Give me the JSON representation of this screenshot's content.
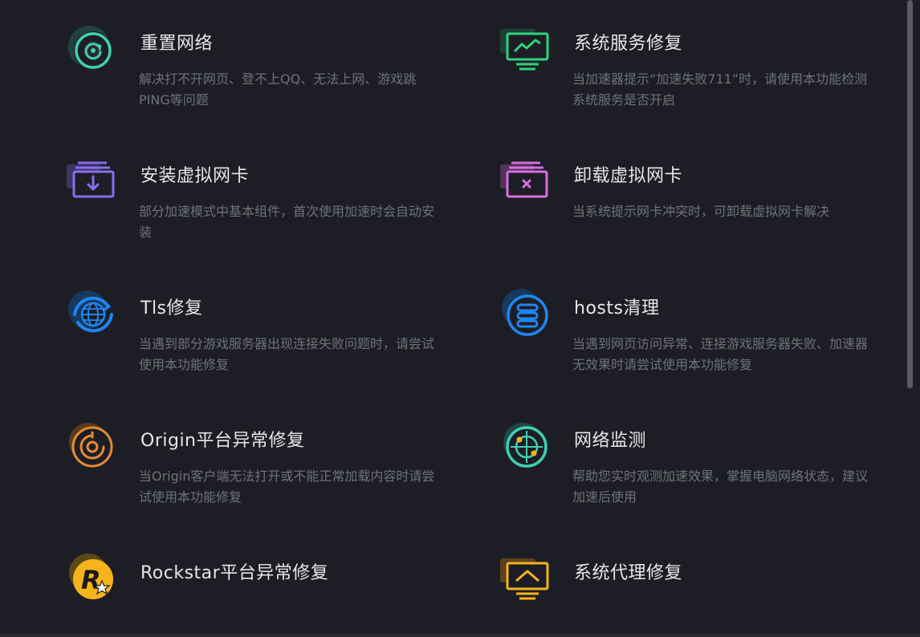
{
  "colors": {
    "background": "#1d1e25",
    "title": "#e6e7ec",
    "description": "#6f7179",
    "teal": "#3fd0b4",
    "green": "#2fd37d",
    "purple": "#8a6cf0",
    "pink": "#d86fe0",
    "blue": "#1f86f2",
    "orange": "#e58a36",
    "yellow": "#f5b41c"
  },
  "tools": [
    {
      "icon": "network-reset-icon",
      "title": "重置网络",
      "desc": "解决打不开网页、登不上QQ、无法上网、游戏跳PING等问题"
    },
    {
      "icon": "system-service-monitor-icon",
      "title": "系统服务修复",
      "desc": "当加速器提示“加速失败711”时，请使用本功能检测系统服务是否开启"
    },
    {
      "icon": "install-adapter-icon",
      "title": "安装虚拟网卡",
      "desc": "部分加速模式中基本组件，首次使用加速时会自动安装"
    },
    {
      "icon": "uninstall-adapter-icon",
      "title": "卸载虚拟网卡",
      "desc": "当系统提示网卡冲突时，可卸载虚拟网卡解决"
    },
    {
      "icon": "globe-refresh-icon",
      "title": "Tls修复",
      "desc": "当遇到部分游戏服务器出现连接失败问题时，请尝试使用本功能修复"
    },
    {
      "icon": "server-stack-icon",
      "title": "hosts清理",
      "desc": "当遇到网页访问异常、连接游戏服务器失败、加速器无效果时请尝试使用本功能修复"
    },
    {
      "icon": "origin-logo-icon",
      "title": "Origin平台异常修复",
      "desc": "当Origin客户端无法打开或不能正常加载内容时请尝试使用本功能修复"
    },
    {
      "icon": "radar-icon",
      "title": "网络监测",
      "desc": "帮助您实时观测加速效果，掌握电脑网络状态，建议加速后使用"
    },
    {
      "icon": "rockstar-logo-icon",
      "title": "Rockstar平台异常修复",
      "desc": ""
    },
    {
      "icon": "proxy-monitor-icon",
      "title": "系统代理修复",
      "desc": ""
    }
  ]
}
